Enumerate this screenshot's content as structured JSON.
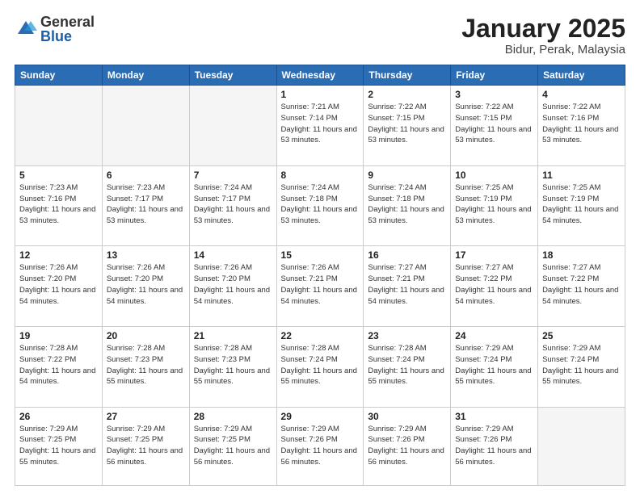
{
  "header": {
    "logo_general": "General",
    "logo_blue": "Blue",
    "title": "January 2025",
    "subtitle": "Bidur, Perak, Malaysia"
  },
  "weekdays": [
    "Sunday",
    "Monday",
    "Tuesday",
    "Wednesday",
    "Thursday",
    "Friday",
    "Saturday"
  ],
  "weeks": [
    [
      {
        "day": "",
        "empty": true
      },
      {
        "day": "",
        "empty": true
      },
      {
        "day": "",
        "empty": true
      },
      {
        "day": "1",
        "sunrise": "7:21 AM",
        "sunset": "7:14 PM",
        "daylight": "11 hours and 53 minutes."
      },
      {
        "day": "2",
        "sunrise": "7:22 AM",
        "sunset": "7:15 PM",
        "daylight": "11 hours and 53 minutes."
      },
      {
        "day": "3",
        "sunrise": "7:22 AM",
        "sunset": "7:15 PM",
        "daylight": "11 hours and 53 minutes."
      },
      {
        "day": "4",
        "sunrise": "7:22 AM",
        "sunset": "7:16 PM",
        "daylight": "11 hours and 53 minutes."
      }
    ],
    [
      {
        "day": "5",
        "sunrise": "7:23 AM",
        "sunset": "7:16 PM",
        "daylight": "11 hours and 53 minutes."
      },
      {
        "day": "6",
        "sunrise": "7:23 AM",
        "sunset": "7:17 PM",
        "daylight": "11 hours and 53 minutes."
      },
      {
        "day": "7",
        "sunrise": "7:24 AM",
        "sunset": "7:17 PM",
        "daylight": "11 hours and 53 minutes."
      },
      {
        "day": "8",
        "sunrise": "7:24 AM",
        "sunset": "7:18 PM",
        "daylight": "11 hours and 53 minutes."
      },
      {
        "day": "9",
        "sunrise": "7:24 AM",
        "sunset": "7:18 PM",
        "daylight": "11 hours and 53 minutes."
      },
      {
        "day": "10",
        "sunrise": "7:25 AM",
        "sunset": "7:19 PM",
        "daylight": "11 hours and 53 minutes."
      },
      {
        "day": "11",
        "sunrise": "7:25 AM",
        "sunset": "7:19 PM",
        "daylight": "11 hours and 54 minutes."
      }
    ],
    [
      {
        "day": "12",
        "sunrise": "7:26 AM",
        "sunset": "7:20 PM",
        "daylight": "11 hours and 54 minutes."
      },
      {
        "day": "13",
        "sunrise": "7:26 AM",
        "sunset": "7:20 PM",
        "daylight": "11 hours and 54 minutes."
      },
      {
        "day": "14",
        "sunrise": "7:26 AM",
        "sunset": "7:20 PM",
        "daylight": "11 hours and 54 minutes."
      },
      {
        "day": "15",
        "sunrise": "7:26 AM",
        "sunset": "7:21 PM",
        "daylight": "11 hours and 54 minutes."
      },
      {
        "day": "16",
        "sunrise": "7:27 AM",
        "sunset": "7:21 PM",
        "daylight": "11 hours and 54 minutes."
      },
      {
        "day": "17",
        "sunrise": "7:27 AM",
        "sunset": "7:22 PM",
        "daylight": "11 hours and 54 minutes."
      },
      {
        "day": "18",
        "sunrise": "7:27 AM",
        "sunset": "7:22 PM",
        "daylight": "11 hours and 54 minutes."
      }
    ],
    [
      {
        "day": "19",
        "sunrise": "7:28 AM",
        "sunset": "7:22 PM",
        "daylight": "11 hours and 54 minutes."
      },
      {
        "day": "20",
        "sunrise": "7:28 AM",
        "sunset": "7:23 PM",
        "daylight": "11 hours and 55 minutes."
      },
      {
        "day": "21",
        "sunrise": "7:28 AM",
        "sunset": "7:23 PM",
        "daylight": "11 hours and 55 minutes."
      },
      {
        "day": "22",
        "sunrise": "7:28 AM",
        "sunset": "7:24 PM",
        "daylight": "11 hours and 55 minutes."
      },
      {
        "day": "23",
        "sunrise": "7:28 AM",
        "sunset": "7:24 PM",
        "daylight": "11 hours and 55 minutes."
      },
      {
        "day": "24",
        "sunrise": "7:29 AM",
        "sunset": "7:24 PM",
        "daylight": "11 hours and 55 minutes."
      },
      {
        "day": "25",
        "sunrise": "7:29 AM",
        "sunset": "7:24 PM",
        "daylight": "11 hours and 55 minutes."
      }
    ],
    [
      {
        "day": "26",
        "sunrise": "7:29 AM",
        "sunset": "7:25 PM",
        "daylight": "11 hours and 55 minutes."
      },
      {
        "day": "27",
        "sunrise": "7:29 AM",
        "sunset": "7:25 PM",
        "daylight": "11 hours and 56 minutes."
      },
      {
        "day": "28",
        "sunrise": "7:29 AM",
        "sunset": "7:25 PM",
        "daylight": "11 hours and 56 minutes."
      },
      {
        "day": "29",
        "sunrise": "7:29 AM",
        "sunset": "7:26 PM",
        "daylight": "11 hours and 56 minutes."
      },
      {
        "day": "30",
        "sunrise": "7:29 AM",
        "sunset": "7:26 PM",
        "daylight": "11 hours and 56 minutes."
      },
      {
        "day": "31",
        "sunrise": "7:29 AM",
        "sunset": "7:26 PM",
        "daylight": "11 hours and 56 minutes."
      },
      {
        "day": "",
        "empty": true
      }
    ]
  ],
  "labels": {
    "sunrise": "Sunrise:",
    "sunset": "Sunset:",
    "daylight": "Daylight:"
  }
}
